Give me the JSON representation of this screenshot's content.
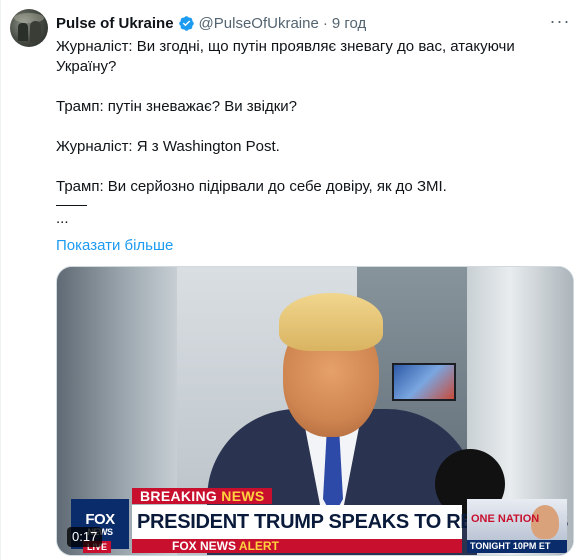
{
  "author": {
    "name": "Pulse of Ukraine",
    "handle": "@PulseOfUkraine",
    "separator": "·",
    "time": "9 год",
    "verified_color": "#1d9bf0"
  },
  "more_icon": "more-horizontal-icon",
  "text": {
    "lines": [
      "Журналіст: Ви згодні, що путін проявляє зневагу до вас, атакуючи Україну?",
      "Трамп: путін зневажає? Ви звідки?",
      "Журналіст: Я з Washington Post.",
      "Трамп: Ви серйозно підірвали до себе довіру, як до ЗМІ."
    ],
    "ellipsis": "...",
    "show_more": "Показати більше"
  },
  "video": {
    "duration": "0:17",
    "breaking_word1": "BREAKING",
    "breaking_word2": "NEWS",
    "headline": "PRESIDENT TRUMP SPEAKS TO REPORTERS",
    "logo_line1": "FOX",
    "logo_line2": "NEWS",
    "live": "LIVE",
    "ticker_brand": "FOX NEWS",
    "ticker_alert": "ALERT",
    "promo_title": "ONE NATION",
    "promo_time": "TONIGHT 10PM ET"
  },
  "colors": {
    "link": "#1d9bf0",
    "text": "#0f1419",
    "muted": "#536471",
    "fox_red": "#c8102e",
    "fox_navy": "#0b2c6b"
  }
}
